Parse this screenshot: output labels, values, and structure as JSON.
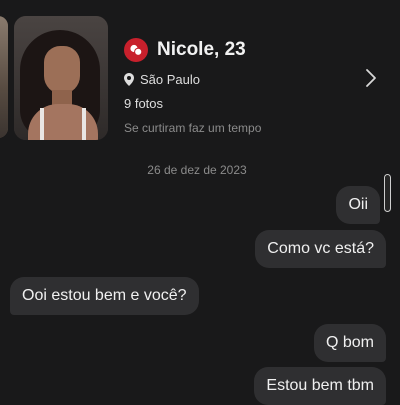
{
  "profile": {
    "name_age": "Nicole, 23",
    "location": "São Paulo",
    "photos": "9 fotos",
    "liked_text": "Se curtiram faz um tempo"
  },
  "chat": {
    "date": "26 de dez de 2023",
    "messages": [
      {
        "text": "Oii",
        "side": "right"
      },
      {
        "text": "Como vc está?",
        "side": "right"
      },
      {
        "text": "Ooi estou bem e você?",
        "side": "left"
      },
      {
        "text": "Q bom",
        "side": "right"
      },
      {
        "text": "Estou bem tbm",
        "side": "right"
      }
    ]
  },
  "icons": {
    "badge": "match-badge-icon",
    "location": "location-pin-icon",
    "chevron": "chevron-right-icon"
  },
  "colors": {
    "background": "#19191a",
    "bubble": "#2f2f31",
    "badge": "#c8202c",
    "muted_text": "#8b8b8b"
  }
}
